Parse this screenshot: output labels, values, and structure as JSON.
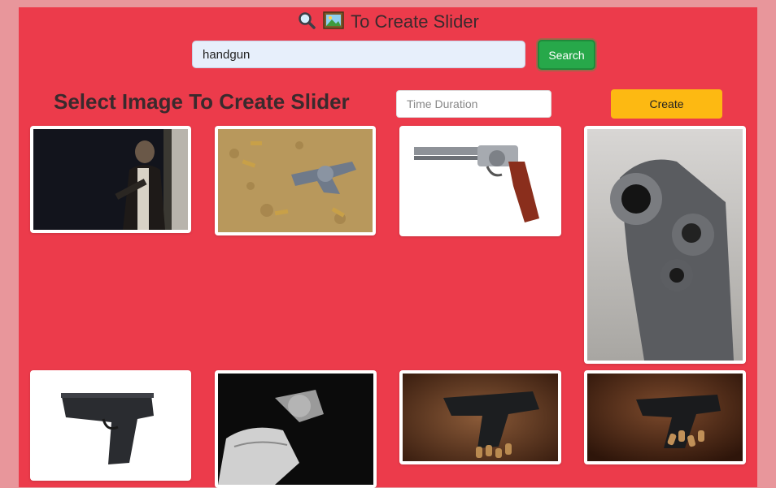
{
  "header": {
    "title": "To Create Slider",
    "search_icon": "magnifier-icon",
    "image_icon": "picture-icon"
  },
  "search": {
    "value": "handgun",
    "button_label": "Search"
  },
  "controls": {
    "heading": "Select Image To Create Slider",
    "duration_placeholder": "Time Duration",
    "create_label": "Create"
  },
  "colors": {
    "page_bg": "#e8969b",
    "panel_bg": "#ec3b4b",
    "search_button": "#27a84a",
    "create_button": "#fdb912"
  },
  "gallery": {
    "images": [
      {
        "subject": "man in suit holding gun in dark doorway"
      },
      {
        "subject": "revolver on sand with bullets"
      },
      {
        "subject": "silver revolver with wooden grip on white"
      },
      {
        "subject": "revolver barrel close-up front view"
      },
      {
        "subject": "black semi-automatic pistol on white"
      },
      {
        "subject": "hand holding revolver black and white"
      },
      {
        "subject": "pistol on wooden table with bullets"
      },
      {
        "subject": "pistol on brown table with cartridges"
      }
    ]
  }
}
